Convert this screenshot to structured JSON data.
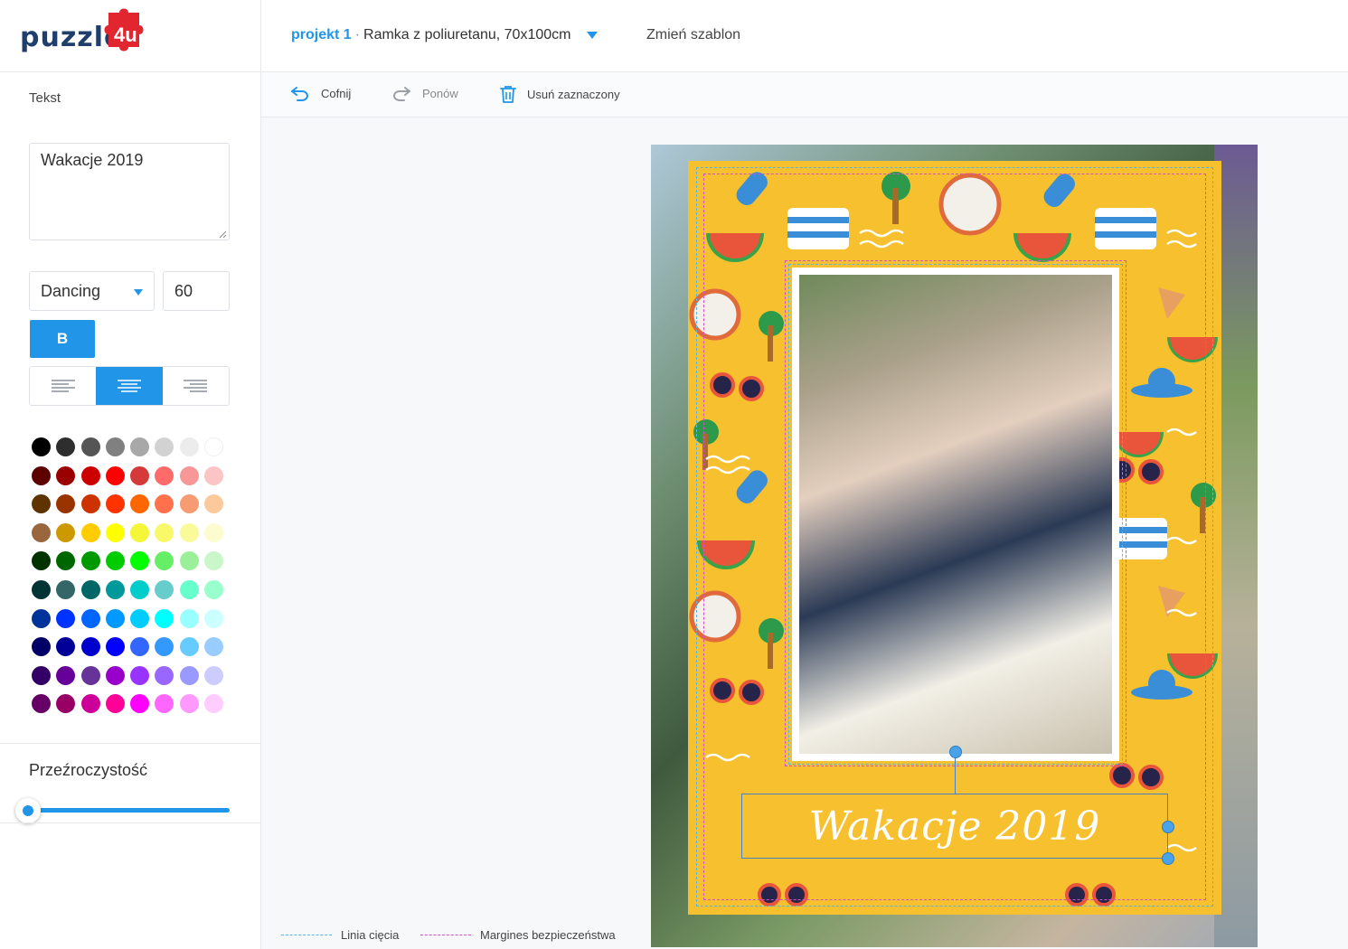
{
  "header": {
    "logo_text": "puzzle",
    "logo_suffix": "4u",
    "project_name": "projekt 1",
    "project_separator": "·",
    "project_title": "Ramka z poliuretanu, 70x100cm",
    "change_template": "Zmień szablon"
  },
  "toolbar": {
    "undo": "Cofnij",
    "redo": "Ponów",
    "delete": "Usuń zaznaczony"
  },
  "sidebar": {
    "section_label": "Tekst",
    "text_value": "Wakacje 2019",
    "font_family": "Dancing",
    "font_size": "60",
    "bold_label": "B",
    "alignment": "center",
    "opacity_label": "Przeźroczystość",
    "opacity_value": 0,
    "palette": [
      [
        "#000000",
        "#2e2e2e",
        "#555555",
        "#808080",
        "#a8a8a8",
        "#d2d2d2",
        "#ececec",
        "#ffffff"
      ],
      [
        "#5c0000",
        "#990000",
        "#cc0000",
        "#ff0000",
        "#d43a3a",
        "#ff6a6a",
        "#f79797",
        "#fcc5c5"
      ],
      [
        "#5e3300",
        "#993300",
        "#cc3300",
        "#ff3300",
        "#ff6600",
        "#ff704d",
        "#f79b72",
        "#fcc99c"
      ],
      [
        "#99663d",
        "#cc9900",
        "#ffcc00",
        "#ffff00",
        "#f5f53a",
        "#f8f86a",
        "#fafa9a",
        "#fcfccf"
      ],
      [
        "#003300",
        "#006600",
        "#009900",
        "#00cc00",
        "#00ff00",
        "#66ee66",
        "#99f099",
        "#c9f7c9"
      ],
      [
        "#003333",
        "#336666",
        "#006666",
        "#009999",
        "#00cccc",
        "#66cccc",
        "#66ffcc",
        "#99ffcc"
      ],
      [
        "#003399",
        "#0033ff",
        "#0066ff",
        "#0099ff",
        "#00ccff",
        "#00ffff",
        "#99ffff",
        "#ccffff"
      ],
      [
        "#000066",
        "#000099",
        "#0000cc",
        "#0000ff",
        "#3366ff",
        "#3399ff",
        "#66ccff",
        "#99ccff"
      ],
      [
        "#330066",
        "#660099",
        "#663399",
        "#9900cc",
        "#9933ff",
        "#9966ff",
        "#9999ff",
        "#ccccff"
      ],
      [
        "#660066",
        "#990066",
        "#cc0099",
        "#ff0099",
        "#ff00ff",
        "#ff66ff",
        "#ff99ff",
        "#ffccff"
      ]
    ]
  },
  "canvas": {
    "poster_text": "Wakacje 2019",
    "legend_cut": "Linia cięcia",
    "legend_safe": "Margines bezpieczeństwa"
  },
  "colors": {
    "accent": "#2196e8",
    "frame": "#f7c02e",
    "cut_line": "#57b6e8",
    "safe_line": "#d250c8"
  }
}
